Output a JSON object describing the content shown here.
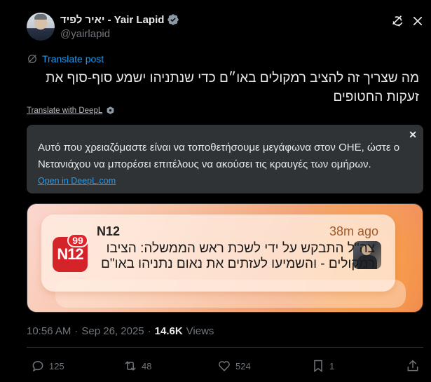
{
  "author": {
    "display_name": "יאיר לפיד - Yair Lapid",
    "handle": "@yairlapid",
    "verified_icon": "verified-badge-icon"
  },
  "translate_post_label": "Translate post",
  "body_text": "מה שצריך זה להציב רמקולים באו״ם כדי שנתניהו ישמע סוף-סוף את זעקות החטופים",
  "deepl": {
    "translate_label": "Translate with DeepL",
    "close_label": "✕",
    "translation": "Αυτό που χρειαζόμαστε είναι να τοποθετήσουμε μεγάφωνα στον ΟΗΕ, ώστε ο Νετανιάχου να μπορέσει επιτέλους να ακούσει τις κραυγές των ομήρων.",
    "open_link": "Open in DeepL.com"
  },
  "media_notification": {
    "app_name": "N12",
    "logo_text": "N12",
    "badge_count": "99",
    "time_ago": "38m ago",
    "text": "צה\"ל התבקש על ידי לשכת ראש הממשלה: הציבו רמקולים - והשמיעו לעזתים את נאום נתניהו באו\"ם"
  },
  "meta": {
    "time": "10:56 AM",
    "separator": "·",
    "date": "Sep 26, 2025",
    "separator2": "·",
    "views_count": "14.6K",
    "views_label": "Views"
  },
  "actions": {
    "replies": "125",
    "reposts": "48",
    "likes": "524",
    "bookmarks": "1"
  },
  "colors": {
    "background": "#000000",
    "accent": "#1d9bf0",
    "muted": "#71767b",
    "text": "#e7e9ea"
  }
}
